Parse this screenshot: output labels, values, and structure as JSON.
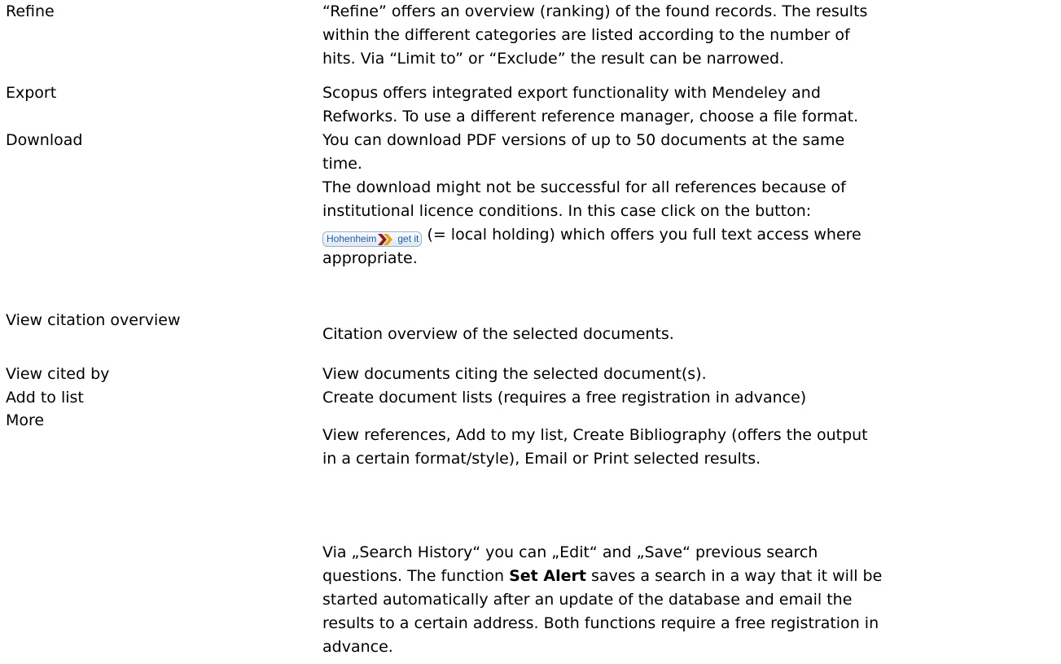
{
  "rows": [
    {
      "label": "Refine",
      "lines": [
        "“Refine” offers an overview (ranking) of the found records. The results",
        "within the different categories are listed according to the number of",
        "hits. Via “Limit to” or “Exclude” the result can be narrowed."
      ]
    },
    {
      "label": "Export",
      "lines": [
        "Scopus offers integrated export functionality with Mendeley and",
        "Refworks. To use a different reference manager, choose a file format."
      ]
    },
    {
      "label": "Download",
      "lines": [
        "You can download PDF versions of up to 50 documents at the same",
        "time.",
        "The download might not be successful for all references because of",
        "institutional licence conditions. In this case click on the button:"
      ],
      "badge_after": "(= local holding) which offers you full text access where",
      "last_line": "appropriate."
    },
    {
      "label": "View citation overview",
      "lines": [
        "Citation overview of the selected documents."
      ]
    },
    {
      "label": "View cited by",
      "lines": [
        "View documents citing the selected document(s)."
      ]
    },
    {
      "label": "Add to list",
      "lines": [
        "Create document lists (requires a free registration in advance)"
      ]
    },
    {
      "label": "More",
      "lines": [
        "View references, Add to my list, Create Bibliography (offers the output",
        "in a certain format/style), Email or Print selected results."
      ]
    }
  ],
  "badge": {
    "left": "Hohenheim",
    "right": "get it",
    "colors": {
      "text": "#1b5ea8",
      "arrow_dark": "#8a1f1f",
      "arrow_light": "#e8a31a"
    }
  },
  "history": {
    "lines": [
      "Via „Search History“ you can „Edit“ and „Save“ previous search",
      "started automatically after an update of the database and email the",
      "results to a certain address. Both functions require a free registration in",
      "advance."
    ],
    "line2_pre": "questions. The function ",
    "line2_bold": "Set Alert",
    "line2_post": " saves a search in a way that it will be"
  }
}
